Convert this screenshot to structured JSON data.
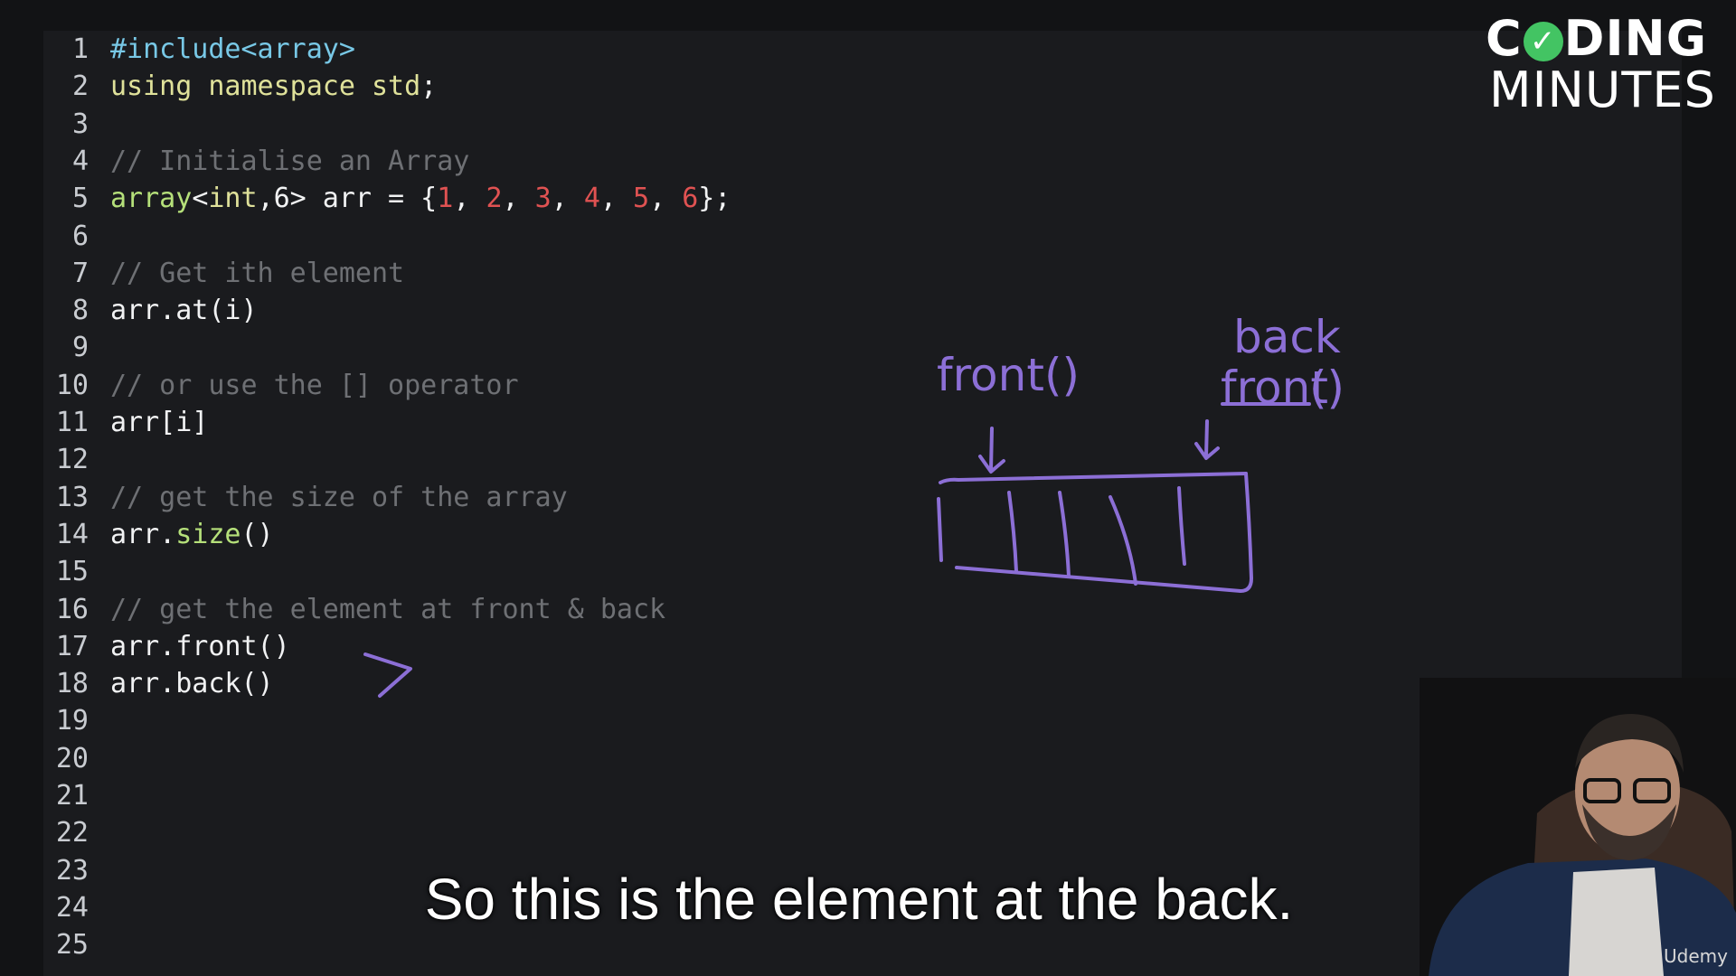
{
  "editor": {
    "lines": [
      {
        "num": "1",
        "tokens": [
          {
            "t": "#include<array>",
            "c": "include"
          }
        ]
      },
      {
        "num": "2",
        "tokens": [
          {
            "t": "using namespace std",
            "c": "keyword"
          },
          {
            "t": ";",
            "c": "plain"
          }
        ]
      },
      {
        "num": "3",
        "tokens": []
      },
      {
        "num": "4",
        "tokens": [
          {
            "t": "// Initialise an Array",
            "c": "comment"
          }
        ]
      },
      {
        "num": "5",
        "tokens": [
          {
            "t": "array",
            "c": "type"
          },
          {
            "t": "<",
            "c": "plain"
          },
          {
            "t": "int",
            "c": "keyword"
          },
          {
            "t": ",6> arr = {",
            "c": "plain"
          },
          {
            "t": "1",
            "c": "number"
          },
          {
            "t": ", ",
            "c": "plain"
          },
          {
            "t": "2",
            "c": "number"
          },
          {
            "t": ", ",
            "c": "plain"
          },
          {
            "t": "3",
            "c": "number"
          },
          {
            "t": ", ",
            "c": "plain"
          },
          {
            "t": "4",
            "c": "number"
          },
          {
            "t": ", ",
            "c": "plain"
          },
          {
            "t": "5",
            "c": "number"
          },
          {
            "t": ", ",
            "c": "plain"
          },
          {
            "t": "6",
            "c": "number"
          },
          {
            "t": "};",
            "c": "plain"
          }
        ]
      },
      {
        "num": "6",
        "tokens": []
      },
      {
        "num": "7",
        "tokens": [
          {
            "t": "// Get ith element",
            "c": "comment"
          }
        ]
      },
      {
        "num": "8",
        "tokens": [
          {
            "t": "arr.at(i)",
            "c": "plain"
          }
        ]
      },
      {
        "num": "9",
        "tokens": []
      },
      {
        "num": "10",
        "tokens": [
          {
            "t": "// or use the [] operator",
            "c": "comment"
          }
        ]
      },
      {
        "num": "11",
        "tokens": [
          {
            "t": "arr[i]",
            "c": "plain"
          }
        ]
      },
      {
        "num": "12",
        "tokens": []
      },
      {
        "num": "13",
        "tokens": [
          {
            "t": "// get the size of the array",
            "c": "comment"
          }
        ]
      },
      {
        "num": "14",
        "tokens": [
          {
            "t": "arr.",
            "c": "plain"
          },
          {
            "t": "size",
            "c": "method"
          },
          {
            "t": "()",
            "c": "plain"
          }
        ]
      },
      {
        "num": "15",
        "tokens": []
      },
      {
        "num": "16",
        "tokens": [
          {
            "t": "// get the element at front & back",
            "c": "comment"
          }
        ]
      },
      {
        "num": "17",
        "tokens": [
          {
            "t": "arr.front()",
            "c": "plain"
          }
        ]
      },
      {
        "num": "18",
        "tokens": [
          {
            "t": "arr.back()",
            "c": "plain"
          }
        ]
      },
      {
        "num": "19",
        "tokens": []
      },
      {
        "num": "20",
        "tokens": []
      },
      {
        "num": "21",
        "tokens": []
      },
      {
        "num": "22",
        "tokens": []
      },
      {
        "num": "23",
        "tokens": []
      },
      {
        "num": "24",
        "tokens": []
      },
      {
        "num": "25",
        "tokens": []
      }
    ]
  },
  "logo": {
    "line1_pre": "C",
    "line1_post": "DING",
    "line2": "MINUTES",
    "check_glyph": "✓",
    "check_color": "#43c463"
  },
  "annotations": {
    "front_label": "front()",
    "back_label": "back",
    "struck_label": "front",
    "struck_suffix": "()",
    "ink_color": "#8c6fd6"
  },
  "caption": "So this is the element at the back.",
  "watermark": "Udemy",
  "icons": {
    "logo_check": "check-circle-icon",
    "pointer_mark": "arrow-pointer-icon"
  }
}
